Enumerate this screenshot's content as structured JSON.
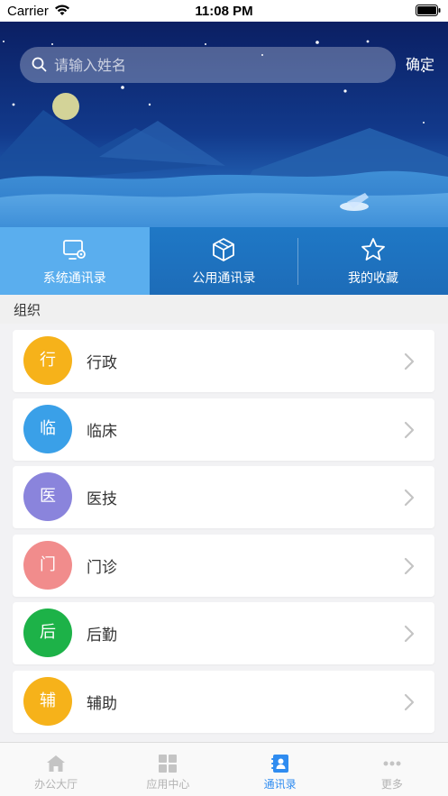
{
  "status_bar": {
    "carrier": "Carrier",
    "time": "11:08 PM"
  },
  "search": {
    "placeholder": "请输入姓名",
    "value": "",
    "confirm_label": "确定",
    "icon": "search-icon"
  },
  "tabs": [
    {
      "label": "系统通讯录",
      "icon": "monitor-gear-icon",
      "active": true
    },
    {
      "label": "公用通讯录",
      "icon": "cube-icon",
      "active": false
    },
    {
      "label": "我的收藏",
      "icon": "star-icon",
      "active": false
    }
  ],
  "section": {
    "title": "组织"
  },
  "orgs": [
    {
      "initial": "行",
      "name": "行政",
      "color": "#f6b21a"
    },
    {
      "initial": "临",
      "name": "临床",
      "color": "#3aa0e8"
    },
    {
      "initial": "医",
      "name": "医技",
      "color": "#8a84dc"
    },
    {
      "initial": "门",
      "name": "门诊",
      "color": "#f18c8c"
    },
    {
      "initial": "后",
      "name": "后勤",
      "color": "#1db248"
    },
    {
      "initial": "辅",
      "name": "辅助",
      "color": "#f6b21a"
    }
  ],
  "bottom_nav": [
    {
      "label": "办公大厅",
      "icon": "home-icon",
      "active": false
    },
    {
      "label": "应用中心",
      "icon": "grid-icon",
      "active": false
    },
    {
      "label": "通讯录",
      "icon": "contacts-icon",
      "active": true
    },
    {
      "label": "更多",
      "icon": "more-icon",
      "active": false
    }
  ],
  "colors": {
    "accent": "#2f8cf0",
    "tab_bg": "#1f78c6",
    "tab_active": "#5aaeee"
  }
}
